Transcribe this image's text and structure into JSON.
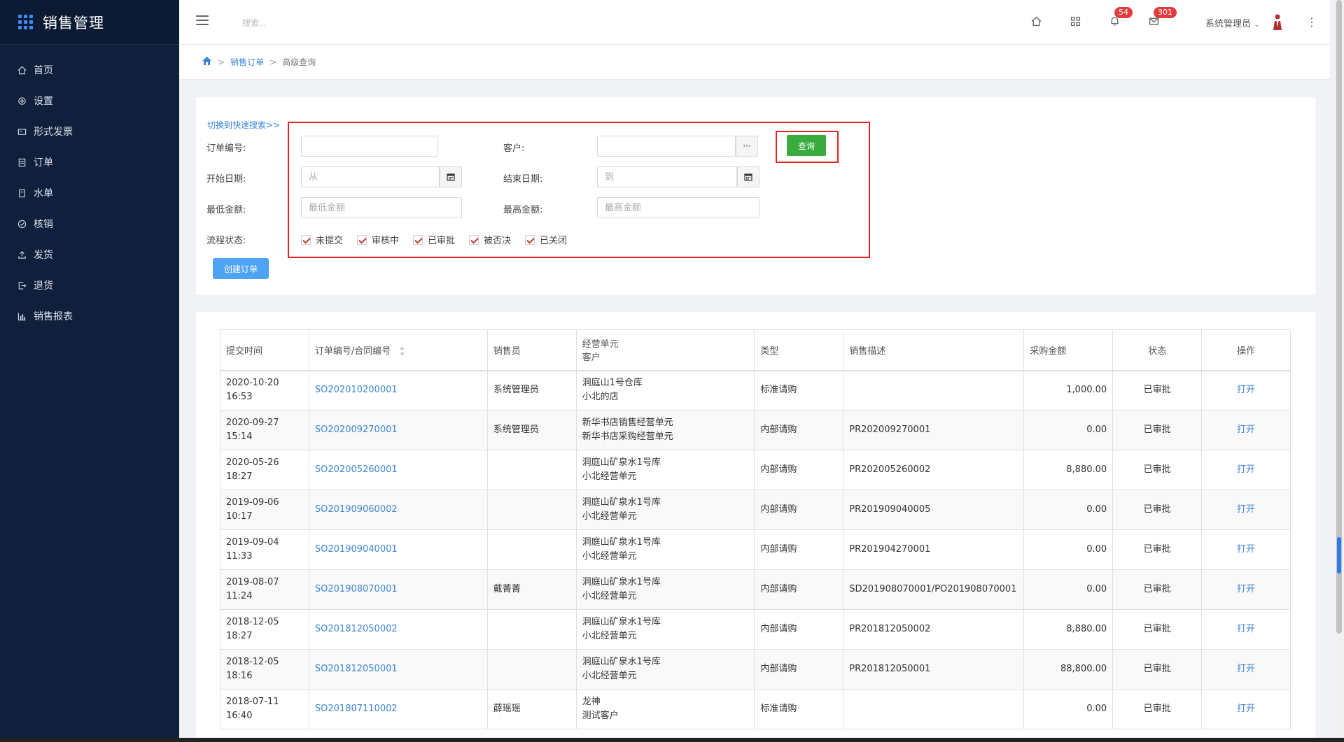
{
  "app": {
    "title": "销售管理"
  },
  "sidebar": {
    "items": [
      {
        "label": "首页",
        "icon": "home-icon"
      },
      {
        "label": "设置",
        "icon": "gear-icon"
      },
      {
        "label": "形式发票",
        "icon": "invoice-icon"
      },
      {
        "label": "订单",
        "icon": "order-icon"
      },
      {
        "label": "水单",
        "icon": "receipt-icon"
      },
      {
        "label": "核销",
        "icon": "check-circle-icon"
      },
      {
        "label": "发货",
        "icon": "upload-icon"
      },
      {
        "label": "退货",
        "icon": "return-icon"
      },
      {
        "label": "销售报表",
        "icon": "bar-chart-icon"
      }
    ]
  },
  "topbar": {
    "search_placeholder": "搜索...",
    "notifications_count": "54",
    "messages_count": "301",
    "user_name": "系统管理员"
  },
  "breadcrumb": {
    "level1": "销售订单",
    "level2": "高级查询"
  },
  "search_form": {
    "quick_search_link": "切换到快速搜索>>",
    "order_no_label": "订单编号:",
    "order_no_value": "",
    "customer_label": "客户:",
    "customer_value": "",
    "start_date_label": "开始日期:",
    "start_date_placeholder": "从",
    "end_date_label": "结束日期:",
    "end_date_placeholder": "到",
    "min_amount_label": "最低金额:",
    "min_amount_placeholder": "最低金额",
    "max_amount_label": "最高金额:",
    "max_amount_placeholder": "最高金额",
    "status_label": "流程状态:",
    "statuses": [
      {
        "label": "未提交",
        "checked": true
      },
      {
        "label": "审核中",
        "checked": true
      },
      {
        "label": "已审批",
        "checked": true
      },
      {
        "label": "被否决",
        "checked": true
      },
      {
        "label": "已关闭",
        "checked": true
      }
    ],
    "query_button": "查询",
    "create_button": "创建订单"
  },
  "table": {
    "headers": {
      "submit_time": "提交时间",
      "order_no": "订单编号/合同编号",
      "salesperson": "销售员",
      "unit_line1": "经营单元",
      "unit_line2": "客户",
      "type": "类型",
      "description": "销售描述",
      "amount": "采购金额",
      "status": "状态",
      "action": "操作"
    },
    "rows": [
      {
        "date": "2020-10-20",
        "time": "16:53",
        "order_no": "SO202010200001",
        "salesperson": "系统管理员",
        "unit": "洞庭山1号仓库",
        "customer": "小北的店",
        "type": "标准请购",
        "description": "",
        "amount": "1,000.00",
        "status": "已审批",
        "action": "打开"
      },
      {
        "date": "2020-09-27",
        "time": "15:14",
        "order_no": "SO202009270001",
        "salesperson": "系统管理员",
        "unit": "新华书店销售经营单元",
        "customer": "新华书店采购经营单元",
        "type": "内部请购",
        "description": "PR202009270001",
        "amount": "0.00",
        "status": "已审批",
        "action": "打开"
      },
      {
        "date": "2020-05-26",
        "time": "18:27",
        "order_no": "SO202005260001",
        "salesperson": "",
        "unit": "洞庭山矿泉水1号库",
        "customer": "小北经营单元",
        "type": "内部请购",
        "description": "PR202005260002",
        "amount": "8,880.00",
        "status": "已审批",
        "action": "打开"
      },
      {
        "date": "2019-09-06",
        "time": "10:17",
        "order_no": "SO201909060002",
        "salesperson": "",
        "unit": "洞庭山矿泉水1号库",
        "customer": "小北经营单元",
        "type": "内部请购",
        "description": "PR201909040005",
        "amount": "0.00",
        "status": "已审批",
        "action": "打开"
      },
      {
        "date": "2019-09-04",
        "time": "11:33",
        "order_no": "SO201909040001",
        "salesperson": "",
        "unit": "洞庭山矿泉水1号库",
        "customer": "小北经营单元",
        "type": "内部请购",
        "description": "PR201904270001",
        "amount": "0.00",
        "status": "已审批",
        "action": "打开"
      },
      {
        "date": "2019-08-07",
        "time": "11:24",
        "order_no": "SO201908070001",
        "salesperson": "戴菁菁",
        "unit": "洞庭山矿泉水1号库",
        "customer": "小北经营单元",
        "type": "内部请购",
        "description": "SD201908070001/PO201908070001",
        "amount": "0.00",
        "status": "已审批",
        "action": "打开"
      },
      {
        "date": "2018-12-05",
        "time": "18:27",
        "order_no": "SO201812050002",
        "salesperson": "",
        "unit": "洞庭山矿泉水1号库",
        "customer": "小北经营单元",
        "type": "内部请购",
        "description": "PR201812050002",
        "amount": "8,880.00",
        "status": "已审批",
        "action": "打开"
      },
      {
        "date": "2018-12-05",
        "time": "18:16",
        "order_no": "SO201812050001",
        "salesperson": "",
        "unit": "洞庭山矿泉水1号库",
        "customer": "小北经营单元",
        "type": "内部请购",
        "description": "PR201812050001",
        "amount": "88,800.00",
        "status": "已审批",
        "action": "打开"
      },
      {
        "date": "2018-07-11",
        "time": "16:40",
        "order_no": "SO201807110002",
        "salesperson": "薛瑶瑶",
        "unit": "龙神",
        "customer": "测试客户",
        "type": "标准请购",
        "description": "",
        "amount": "0.00",
        "status": "已审批",
        "action": "打开"
      }
    ]
  },
  "colors": {
    "sidebar_bg": "#0f1f3c",
    "accent": "#3d86d7",
    "query_button": "#3aab3e",
    "highlight": "#e02424",
    "badge": "#e23b3b"
  }
}
